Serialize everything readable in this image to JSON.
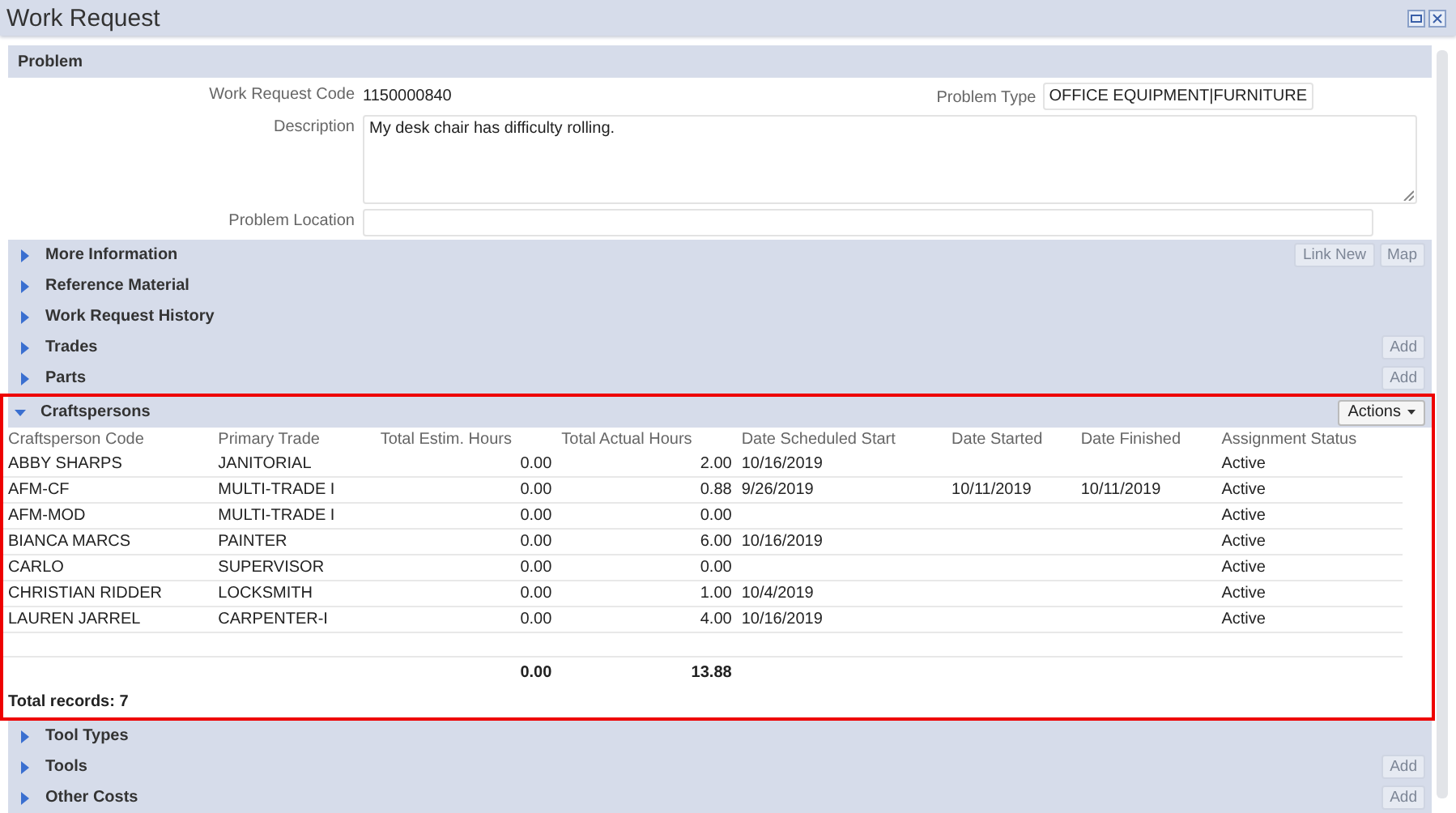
{
  "window": {
    "title": "Work Request"
  },
  "problem": {
    "title": "Problem",
    "code_label": "Work Request Code",
    "code": "1150000840",
    "type_label": "Problem Type",
    "type": "OFFICE EQUIPMENT|FURNITURE",
    "description_label": "Description",
    "description": "My desk chair has difficulty rolling.",
    "location_label": "Problem Location"
  },
  "sections": [
    {
      "title": "More Information",
      "expanded": false,
      "highlighted": false,
      "buttons": [
        {
          "label": "Link New",
          "disabled": true
        },
        {
          "label": "Map",
          "disabled": true
        }
      ]
    },
    {
      "title": "Reference Material",
      "expanded": false,
      "highlighted": false
    },
    {
      "title": "Work Request History",
      "expanded": false,
      "highlighted": false
    },
    {
      "title": "Trades",
      "expanded": false,
      "highlighted": false,
      "buttons": [
        {
          "label": "Add",
          "disabled": true
        }
      ]
    },
    {
      "title": "Parts",
      "expanded": false,
      "highlighted": false,
      "buttons": [
        {
          "label": "Add",
          "disabled": true
        }
      ]
    },
    {
      "title": "Craftspersons",
      "expanded": true,
      "highlighted": true,
      "menu_button": "Actions",
      "table": {
        "columns": [
          "Craftsperson Code",
          "Primary Trade",
          "Total Estim. Hours",
          "Total Actual Hours",
          "Date Scheduled Start",
          "Date Started",
          "Date Finished",
          "Assignment Status"
        ],
        "rows": [
          [
            "ABBY SHARPS",
            "JANITORIAL",
            "0.00",
            "2.00",
            "10/16/2019",
            "",
            "",
            "Active"
          ],
          [
            "AFM-CF",
            "MULTI-TRADE I",
            "0.00",
            "0.88",
            "9/26/2019",
            "10/11/2019",
            "10/11/2019",
            "Active"
          ],
          [
            "AFM-MOD",
            "MULTI-TRADE I",
            "0.00",
            "0.00",
            "",
            "",
            "",
            "Active"
          ],
          [
            "BIANCA MARCS",
            "PAINTER",
            "0.00",
            "6.00",
            "10/16/2019",
            "",
            "",
            "Active"
          ],
          [
            "CARLO",
            "SUPERVISOR",
            "0.00",
            "0.00",
            "",
            "",
            "",
            "Active"
          ],
          [
            "CHRISTIAN RIDDER",
            "LOCKSMITH",
            "0.00",
            "1.00",
            "10/4/2019",
            "",
            "",
            "Active"
          ],
          [
            "LAUREN JARREL",
            "CARPENTER-I",
            "0.00",
            "4.00",
            "10/16/2019",
            "",
            "",
            "Active"
          ]
        ],
        "total_estim_hours": "0.00",
        "total_actual_hours": "13.88",
        "total_records": "Total records: 7"
      }
    },
    {
      "title": "Tool Types",
      "expanded": false,
      "highlighted": false
    },
    {
      "title": "Tools",
      "expanded": false,
      "highlighted": false,
      "buttons": [
        {
          "label": "Add",
          "disabled": true
        }
      ]
    },
    {
      "title": "Other Costs",
      "expanded": false,
      "highlighted": false,
      "buttons": [
        {
          "label": "Add",
          "disabled": true
        }
      ]
    }
  ]
}
